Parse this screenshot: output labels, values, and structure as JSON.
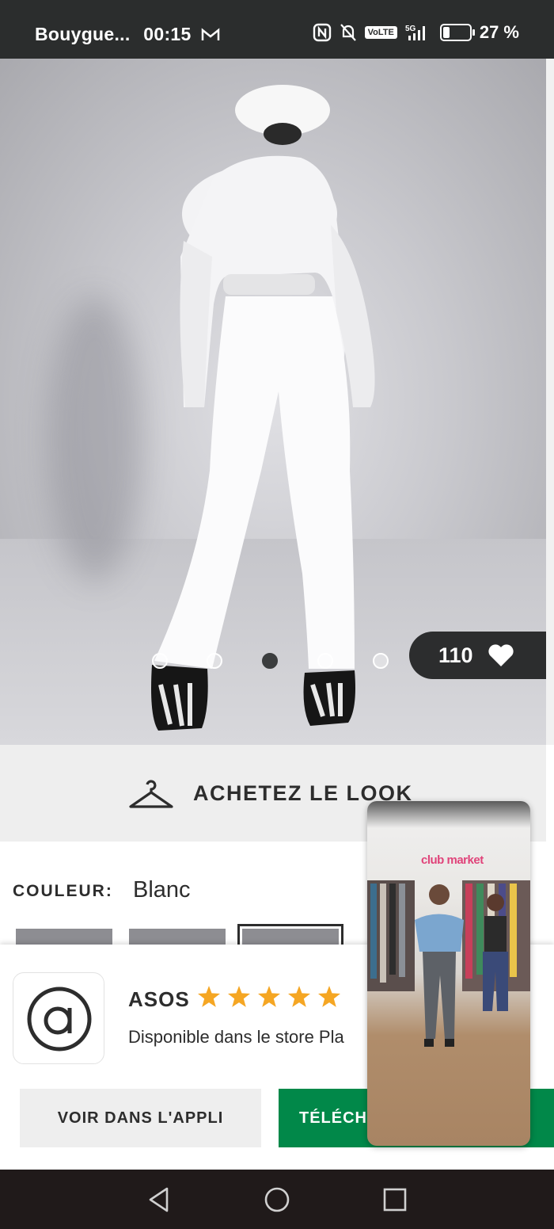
{
  "status_bar": {
    "carrier": "Bouygue...",
    "time": "00:15",
    "network": "5G",
    "volte": "VoLTE",
    "battery": "27 %",
    "battery_level": 0.27
  },
  "product": {
    "image_alt": "white ski suit back view",
    "carousel": {
      "total": 5,
      "active_index": 2
    },
    "likes": "110"
  },
  "shop_the_look": {
    "label": "ACHETEZ LE LOOK"
  },
  "colour": {
    "label": "COULEUR:",
    "value": "Blanc",
    "swatch_count": 3,
    "selected_swatch": 2
  },
  "app_banner": {
    "app_name": "ASOS",
    "rating_stars": 5,
    "availability": "Disponible dans le store Pla",
    "view_in_app_label": "VOIR DANS L'APPLI",
    "download_label": "TÉLÉCHA"
  },
  "video_pip": {
    "sign_text": "club market"
  },
  "colors": {
    "status_bar": "#2b2d2d",
    "likes_pill": "#2c2d2e",
    "download_green": "#018849",
    "star_yellow": "#f5a623",
    "nav_bar": "#201a1a"
  },
  "nav": {
    "back_icon": "triangle-back-icon",
    "home_icon": "circle-home-icon",
    "recents_icon": "square-recents-icon"
  }
}
